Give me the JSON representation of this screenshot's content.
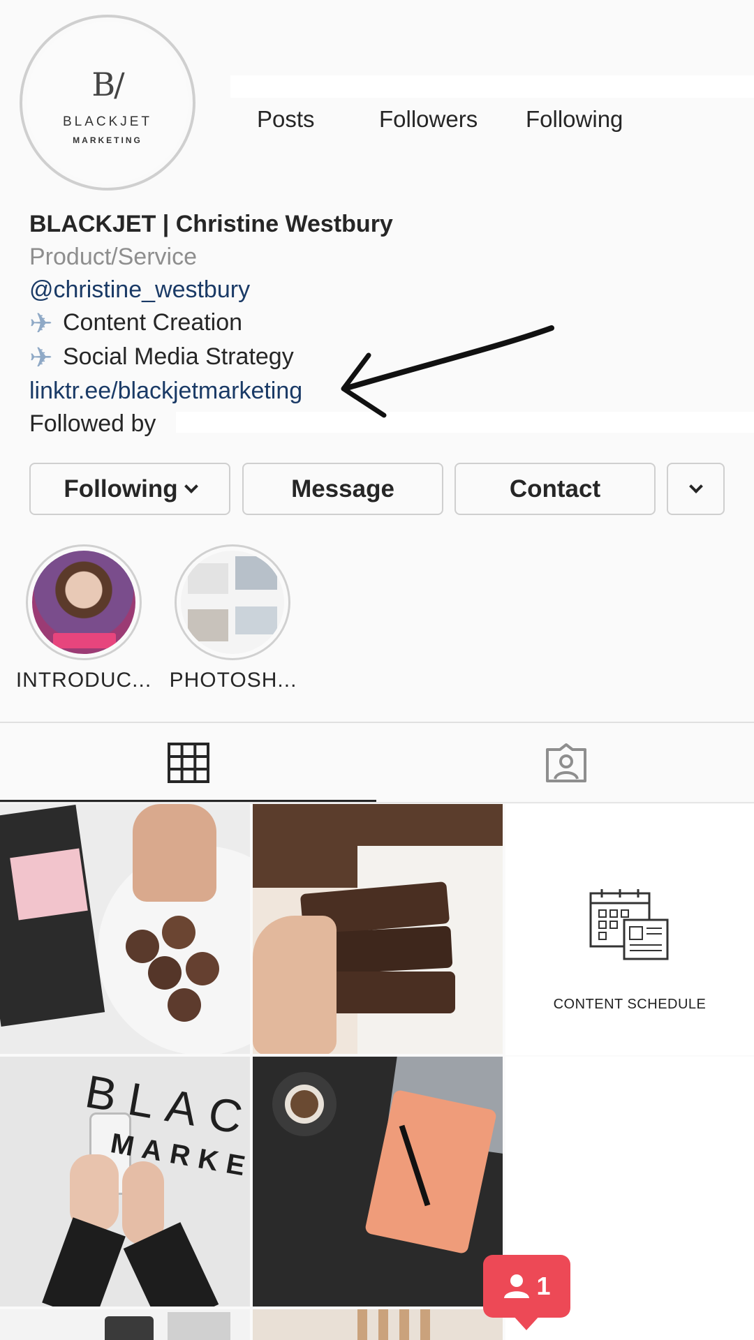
{
  "profile": {
    "avatar_logo_mark": "B/",
    "avatar_logo_word": "BLACKJET",
    "avatar_logo_sub": "MARKETING",
    "stats": {
      "posts_label": "Posts",
      "followers_label": "Followers",
      "following_label": "Following"
    },
    "name": "BLACKJET | Christine Westbury",
    "category": "Product/Service",
    "handle": "@christine_westbury",
    "bio_lines": [
      "Content Creation",
      "Social Media Strategy"
    ],
    "bio_icon": "airplane-icon",
    "link": "linktr.ee/blackjetmarketing",
    "followed_by_prefix": "Followed by"
  },
  "actions": {
    "following_label": "Following",
    "message_label": "Message",
    "contact_label": "Contact"
  },
  "highlights": [
    {
      "label": "INTRODUC..."
    },
    {
      "label": "PHOTOSH..."
    }
  ],
  "tabs": [
    "grid-icon",
    "tagged-icon"
  ],
  "grid": {
    "tile3_caption": "CONTENT SCHEDULE",
    "tile6_word1": "BLAC",
    "tile6_word2": "MARKE"
  },
  "notification": {
    "count": "1",
    "icon": "person-icon",
    "color": "#ed4956"
  },
  "colors": {
    "link": "#1a3a66",
    "category": "#8e8e8e",
    "border": "#cfcfcf"
  }
}
